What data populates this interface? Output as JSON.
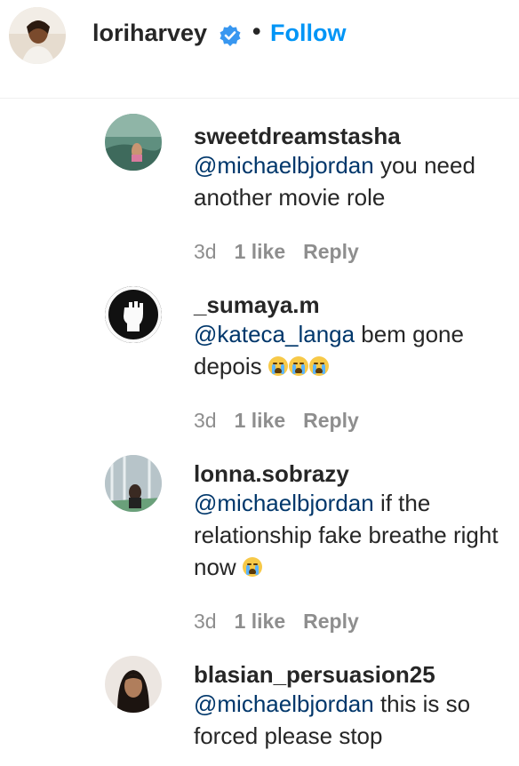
{
  "header": {
    "username": "loriharvey",
    "separator": "•",
    "follow_label": "Follow",
    "avatar_icon": "profile-photo-icon",
    "verified_icon": "verified-badge-icon",
    "accent_color": "#0095f6"
  },
  "comments": [
    {
      "username": "sweetdreamstasha",
      "mention": "@michaelbjordan",
      "text": " you need another movie role",
      "time": "3d",
      "likes": "1 like",
      "reply_label": "Reply"
    },
    {
      "username": "_sumaya.m",
      "mention": "@kateca_langa",
      "text": " bem gone depois",
      "time": "3d",
      "likes": "1 like",
      "reply_label": "Reply"
    },
    {
      "username": "lonna.sobrazy",
      "mention": "@michaelbjordan",
      "text": " if the relationship fake breathe right now ",
      "time": "3d",
      "likes": "1 like",
      "reply_label": "Reply"
    },
    {
      "username": "blasian_persuasion25",
      "mention": "@michaelbjordan",
      "text": " this is so forced please stop"
    }
  ],
  "colors": {
    "mention": "#00376b",
    "meta": "#8e8e8e",
    "text": "#262626"
  }
}
